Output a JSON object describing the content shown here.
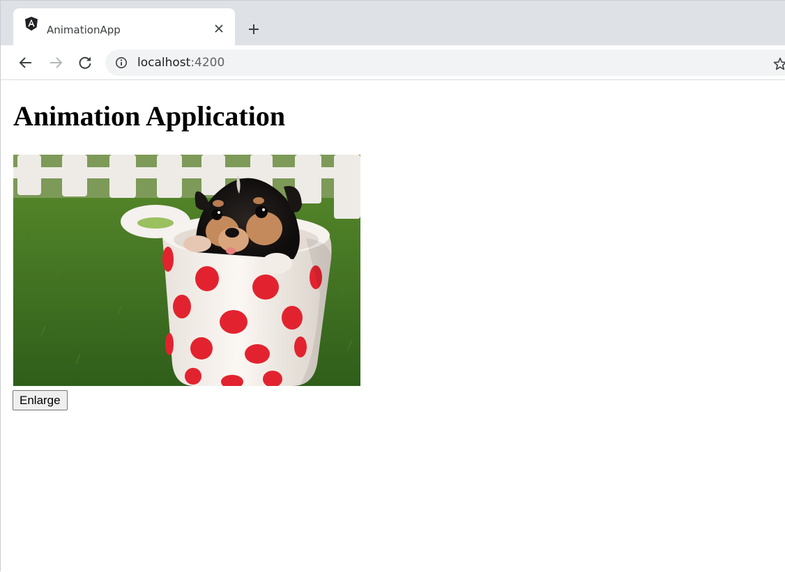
{
  "browser": {
    "tab": {
      "title": "AnimationApp",
      "favicon": "angular-logo-icon"
    },
    "omnibox": {
      "host": "localhost",
      "port": ":4200"
    },
    "icons": {
      "close": "close-icon",
      "new_tab": "plus-icon",
      "back": "arrow-left-icon",
      "forward": "arrow-right-icon",
      "reload": "reload-icon",
      "info": "info-icon",
      "bookmark": "star-icon"
    },
    "colors": {
      "tab_strip": "#dee1e6",
      "omnibox": "#f1f3f4"
    }
  },
  "page": {
    "heading": "Animation Application",
    "image": "puppy-in-polka-dot-cup-photo",
    "button_label": "Enlarge"
  }
}
